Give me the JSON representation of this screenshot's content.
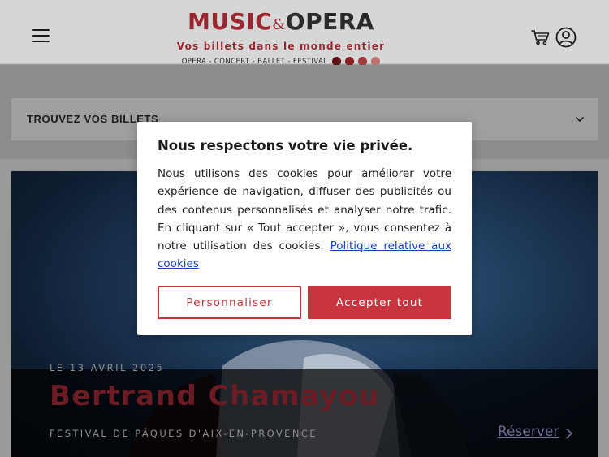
{
  "header": {
    "logo": {
      "word1": "MUSIC",
      "amp": "&",
      "word2": "OPERA",
      "tagline": "Vos billets dans le monde entier",
      "subline": "OPERA - CONCERT - BALLET - FESTIVAL",
      "dot_colors": [
        "#5e0f12",
        "#8a1e22",
        "#a4393a",
        "#c07371"
      ]
    },
    "icons": {
      "menu": "hamburger-icon",
      "cart": "cart-icon",
      "account": "user-icon"
    }
  },
  "filter": {
    "label": "TROUVEZ VOS BILLETS",
    "icon": "chevron-down-icon"
  },
  "hero": {
    "date": "LE 13 AVRIL 2025",
    "title": "Bertrand Chamayou",
    "venue": "FESTIVAL DE PÂQUES D'AIX-EN-PROVENCE",
    "reserve_label": "Réserver",
    "reserve_icon": "chevron-right-icon"
  },
  "cookie_modal": {
    "title": "Nous respectons votre vie privée.",
    "body": "Nous utilisons des cookies pour améliorer votre expérience de navigation, diffuser des publicités ou des contenus personnalisés et analyser notre trafic. En cliquant sur « Tout accepter », vous consentez à notre utilisation des cookies.",
    "policy_link": "Politique relative aux cookies",
    "customize_label": "Personnaliser",
    "accept_label": "Accepter tout"
  },
  "colors": {
    "brand_red": "#c8353f",
    "link_blue": "#1a40c2"
  }
}
